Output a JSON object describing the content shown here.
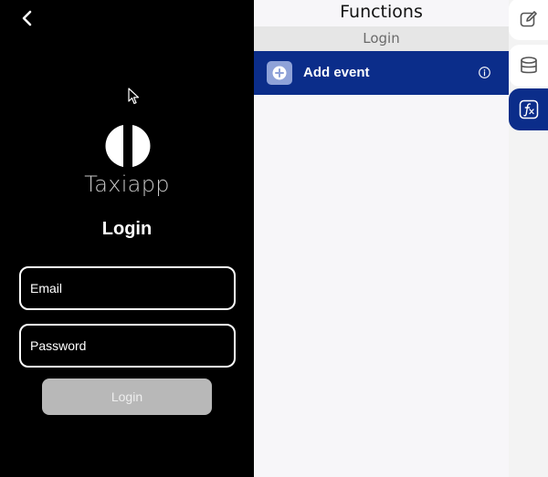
{
  "app": {
    "brand_name": "Taxiapp",
    "login_heading": "Login",
    "email_placeholder": "Email",
    "password_placeholder": "Password",
    "login_button_label": "Login"
  },
  "functions_panel": {
    "title": "Functions",
    "screen_name": "Login",
    "add_event_label": "Add event"
  },
  "rail": {
    "tabs": [
      {
        "icon": "edit-icon",
        "active": false
      },
      {
        "icon": "database-icon",
        "active": false
      },
      {
        "icon": "function-icon",
        "active": true
      }
    ]
  },
  "colors": {
    "accent": "#0b2d8a",
    "phone_background": "#000000",
    "panel_background": "#f7f6f9",
    "disabled_button": "#b8b8b8"
  }
}
